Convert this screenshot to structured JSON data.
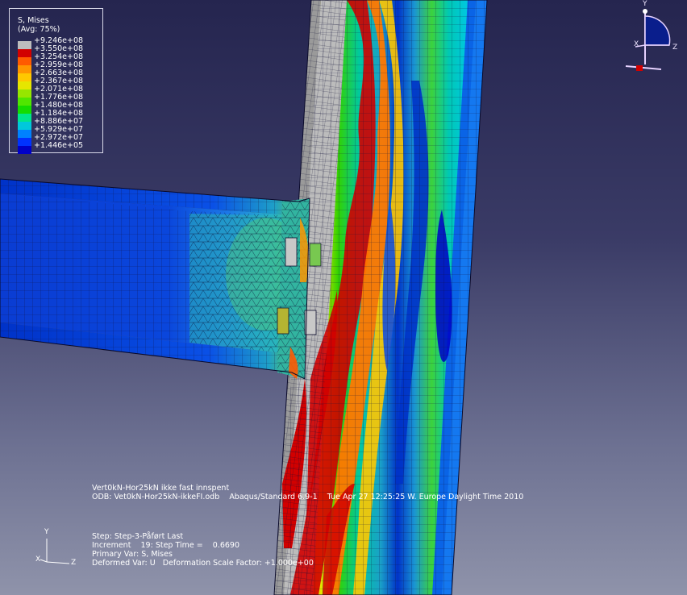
{
  "legend": {
    "title": "S, Mises",
    "subtitle": "(Avg: 75%)",
    "colors": [
      "#bdbdbd",
      "#d20000",
      "#ff5a00",
      "#ff9600",
      "#ffc800",
      "#e6e600",
      "#96e600",
      "#50e600",
      "#14dc00",
      "#00e68c",
      "#00c8dc",
      "#0082ff",
      "#0032ff",
      "#0000c8"
    ],
    "ticks": [
      "+9.246e+08",
      "+3.550e+08",
      "+3.254e+08",
      "+2.959e+08",
      "+2.663e+08",
      "+2.367e+08",
      "+2.071e+08",
      "+1.776e+08",
      "+1.480e+08",
      "+1.184e+08",
      "+8.886e+07",
      "+5.929e+07",
      "+2.972e+07",
      "+1.446e+05"
    ]
  },
  "info": {
    "line1": "Vert0kN-Hor25kN ikke fast innspent",
    "line2": "ODB: Vet0kN-Hor25kN-ikkeFI.odb    Abaqus/Standard 6.9-1    Tue Apr 27 12:25:25 W. Europe Daylight Time 2010",
    "line3": "Step: Step-3-Påført Last",
    "line4": "Increment    19: Step Time =    0.6690",
    "line5": "Primary Var: S, Mises",
    "line6": "Deformed Var: U   Deformation Scale Factor: +1.000e+00"
  },
  "triad_view": {
    "y": "Y",
    "x": "X",
    "z": "Z"
  },
  "triad_global": {
    "y": "Y",
    "x": "X",
    "z": "Z"
  }
}
